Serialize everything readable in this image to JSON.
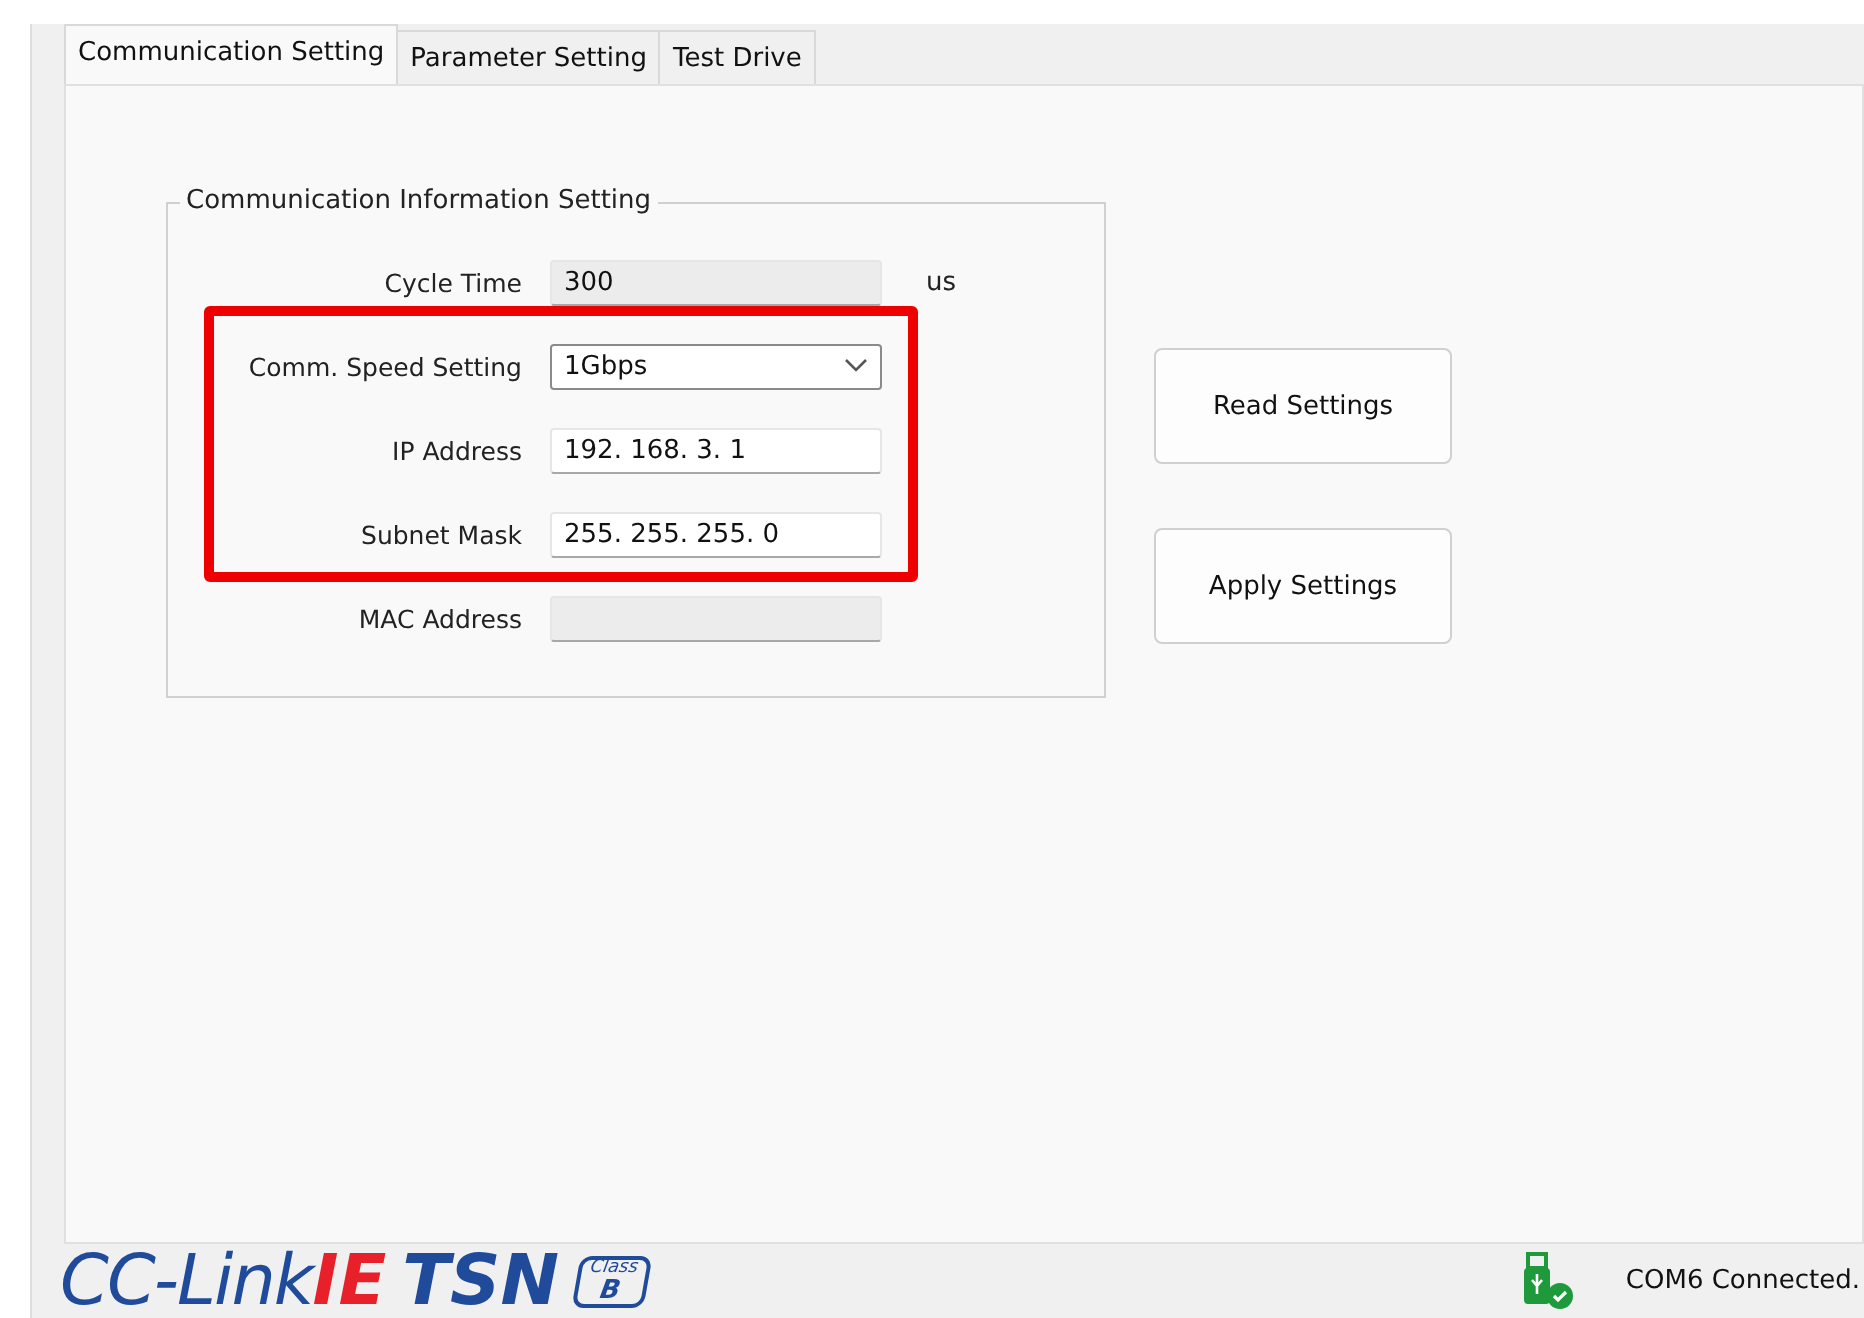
{
  "tabs": [
    {
      "label": "Communication Setting",
      "selected": true
    },
    {
      "label": "Parameter Setting",
      "selected": false
    },
    {
      "label": "Test Drive",
      "selected": false
    }
  ],
  "group": {
    "title": "Communication Information Setting",
    "rows": [
      {
        "label": "Cycle Time",
        "kind": "readonly",
        "value": "300",
        "unit": "us",
        "highlighted": false
      },
      {
        "label": "Comm. Speed Setting",
        "kind": "select",
        "value": "1Gbps",
        "highlighted": true
      },
      {
        "label": "IP Address",
        "kind": "input",
        "value": "192. 168. 3. 1",
        "highlighted": true
      },
      {
        "label": "Subnet Mask",
        "kind": "input",
        "value": "255. 255. 255. 0",
        "highlighted": true
      },
      {
        "label": "MAC Address",
        "kind": "readonly",
        "highlighted": false
      }
    ]
  },
  "buttons": [
    "Read Settings",
    "Apply Settings"
  ],
  "logo": {
    "name": "CC-Link",
    "accent": "IE",
    "suffix": "TSN",
    "badge_top": "Class",
    "badge_bottom": "B"
  },
  "status": {
    "text": "COM6 Connected.",
    "connected": true
  }
}
